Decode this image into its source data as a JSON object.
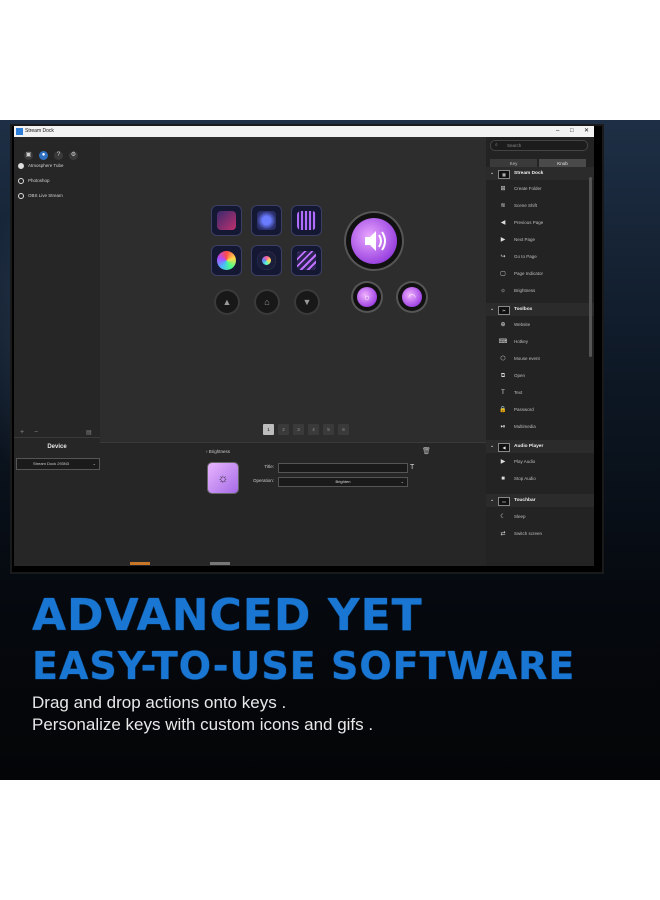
{
  "window": {
    "title": "Stream Dock",
    "min": "–",
    "max": "□",
    "close": "✕"
  },
  "left_toolbar": [
    {
      "icon": "cube-icon",
      "glyph": "▣",
      "active": false
    },
    {
      "icon": "user-icon",
      "glyph": "●",
      "active": true
    },
    {
      "icon": "help-icon",
      "glyph": "?",
      "active": false
    },
    {
      "icon": "settings-icon",
      "glyph": "⚙",
      "active": false
    }
  ],
  "profiles": [
    {
      "label": "Atmosphere Tube",
      "selected": true
    },
    {
      "label": "Photoshop",
      "selected": false
    },
    {
      "label": "OBS Live Stream",
      "selected": false
    }
  ],
  "device": {
    "plus": "+",
    "minus": "−",
    "heading": "Device",
    "selected": "Stream Dock 293N3",
    "caret": "⌄"
  },
  "pages": [
    "1",
    "2",
    "3",
    "4",
    "5",
    "6"
  ],
  "properties": {
    "title": "Brightness",
    "title_label": "Title:",
    "title_value": "",
    "t_glyph": "T",
    "operation_label": "Operation:",
    "operation_value": "Brighten",
    "caret": "⌄"
  },
  "actions_panel": {
    "search_placeholder": "Search",
    "tabs": [
      "Key",
      "Knob"
    ],
    "categories": [
      {
        "label": "Stream Dock",
        "actions": [
          {
            "icon": "folder-plus-icon",
            "glyph": "⊞",
            "label": "Create Folder"
          },
          {
            "icon": "layers-icon",
            "glyph": "≋",
            "label": "Scene Shift"
          },
          {
            "icon": "arrow-left-circle-icon",
            "glyph": "◀",
            "label": "Previous Page"
          },
          {
            "icon": "arrow-right-circle-icon",
            "glyph": "▶",
            "label": "Next Page"
          },
          {
            "icon": "goto-page-icon",
            "glyph": "↪",
            "label": "Go to Page"
          },
          {
            "icon": "page-indicator-icon",
            "glyph": "▢",
            "label": "Page Indicator"
          },
          {
            "icon": "sun-icon",
            "glyph": "☼",
            "label": "Brightness"
          }
        ]
      },
      {
        "label": "Toolbox",
        "actions": [
          {
            "icon": "globe-icon",
            "glyph": "⊕",
            "label": "Website"
          },
          {
            "icon": "keyboard-icon",
            "glyph": "⌨",
            "label": "Hotkey"
          },
          {
            "icon": "mouse-icon",
            "glyph": "⬡",
            "label": "Mouse event"
          },
          {
            "icon": "open-icon",
            "glyph": "⧉",
            "label": "Open"
          },
          {
            "icon": "text-icon",
            "glyph": "T",
            "label": "Text"
          },
          {
            "icon": "lock-icon",
            "glyph": "🔒",
            "label": "Password"
          },
          {
            "icon": "multimedia-icon",
            "glyph": "⏯",
            "label": "Multimedia"
          }
        ]
      },
      {
        "label": "Audio Player",
        "actions": [
          {
            "icon": "play-icon",
            "glyph": "▶",
            "label": "Play Audio"
          },
          {
            "icon": "stop-icon",
            "glyph": "■",
            "label": "Stop Audio"
          }
        ]
      },
      {
        "label": "Touchbar",
        "actions": [
          {
            "icon": "moon-icon",
            "glyph": "☾",
            "label": "Sleep"
          },
          {
            "icon": "switch-screen-icon",
            "glyph": "⇄",
            "label": "Switch screen"
          }
        ]
      }
    ]
  },
  "headline": {
    "line1": "ADVANCED YET",
    "line2": "EASY-TO-USE SOFTWARE"
  },
  "subtext": {
    "line1": "Drag and drop actions onto keys .",
    "line2": "Personalize keys with custom icons and gifs ."
  },
  "colors": {
    "headline": "#1976d2",
    "accent_purple": "#a246e4",
    "key_glow": "#3b3f63"
  }
}
